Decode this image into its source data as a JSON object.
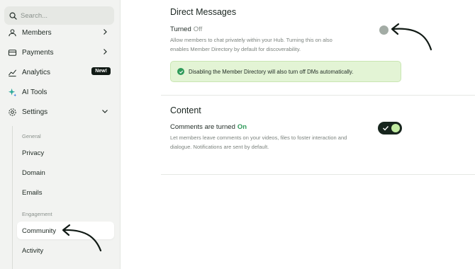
{
  "sidebar": {
    "search_placeholder": "Search...",
    "items": [
      {
        "label": "Members",
        "icon": "members-icon"
      },
      {
        "label": "Payments",
        "icon": "payments-icon"
      },
      {
        "label": "Analytics",
        "icon": "analytics-icon",
        "badge": "New!"
      },
      {
        "label": "AI Tools",
        "icon": "ai-sparkle-icon"
      },
      {
        "label": "Settings",
        "icon": "gear-icon"
      }
    ],
    "settings_sections": {
      "general_label": "General",
      "general_items": [
        "Privacy",
        "Domain",
        "Emails"
      ],
      "engagement_label": "Engagement",
      "engagement_items": [
        "Community",
        "Activity"
      ]
    },
    "active_item": "Community"
  },
  "main": {
    "direct_messages": {
      "title": "Direct Messages",
      "toggle_label": "Turned",
      "toggle_state": "Off",
      "description": "Allow members to chat privately within your Hub. Turning this on also enables Member Directory by default for discoverability.",
      "notice": "Disabling the Member Directory will also turn off DMs automatically."
    },
    "content": {
      "title": "Content",
      "toggle_label": "Comments are turned",
      "toggle_state": "On",
      "description": "Let members leave comments on your videos, files to foster interaction and dialogue. Notifications are sent by default."
    }
  },
  "colors": {
    "accent_green": "#2f9a5a",
    "notice_bg": "#e3f4d5",
    "toggle_dark": "#17251d",
    "knob_on": "#c2eca2"
  }
}
